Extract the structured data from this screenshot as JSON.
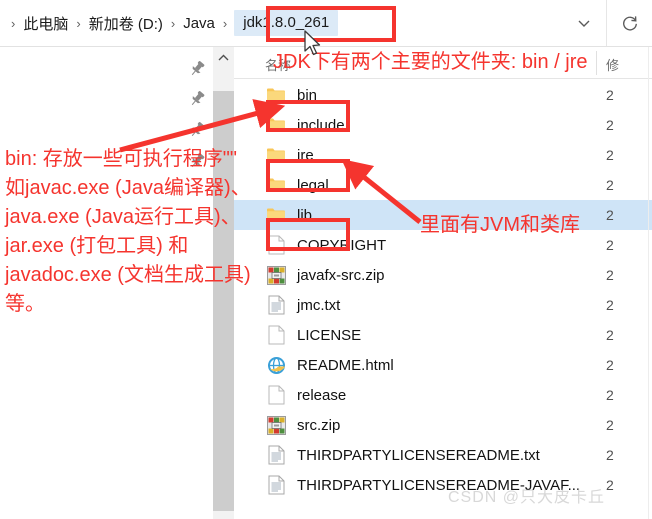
{
  "address_bar": {
    "breadcrumbs": [
      {
        "label": "此电脑"
      },
      {
        "label": "新加卷 (D:)"
      },
      {
        "label": "Java"
      }
    ],
    "current_folder": "jdk1.8.0_261",
    "separator": "›",
    "dropdown_icon": "chevron-down-icon",
    "refresh_icon": "refresh-icon"
  },
  "columns": {
    "name": "名称",
    "date": "修"
  },
  "files": [
    {
      "name": "bin",
      "icon": "folder-icon",
      "date": "2",
      "selected": false,
      "highlighted": true
    },
    {
      "name": "include",
      "icon": "folder-icon",
      "date": "2",
      "selected": false,
      "highlighted": false
    },
    {
      "name": "jre",
      "icon": "folder-icon",
      "date": "2",
      "selected": false,
      "highlighted": true
    },
    {
      "name": "legal",
      "icon": "folder-icon",
      "date": "2",
      "selected": false,
      "highlighted": false
    },
    {
      "name": "lib",
      "icon": "folder-icon",
      "date": "2",
      "selected": true,
      "highlighted": true
    },
    {
      "name": "COPYRIGHT",
      "icon": "blank-file-icon",
      "date": "2",
      "selected": false,
      "highlighted": false
    },
    {
      "name": "javafx-src.zip",
      "icon": "zip-icon",
      "date": "2",
      "selected": false,
      "highlighted": false
    },
    {
      "name": "jmc.txt",
      "icon": "text-file-icon",
      "date": "2",
      "selected": false,
      "highlighted": false
    },
    {
      "name": "LICENSE",
      "icon": "blank-file-icon",
      "date": "2",
      "selected": false,
      "highlighted": false
    },
    {
      "name": "README.html",
      "icon": "browser-icon",
      "date": "2",
      "selected": false,
      "highlighted": false
    },
    {
      "name": "release",
      "icon": "blank-file-icon",
      "date": "2",
      "selected": false,
      "highlighted": false
    },
    {
      "name": "src.zip",
      "icon": "zip-icon",
      "date": "2",
      "selected": false,
      "highlighted": false
    },
    {
      "name": "THIRDPARTYLICENSEREADME.txt",
      "icon": "text-file-icon",
      "date": "2",
      "selected": false,
      "highlighted": false
    },
    {
      "name": "THIRDPARTYLICENSEREADME-JAVAF...",
      "icon": "text-file-icon",
      "date": "2",
      "selected": false,
      "highlighted": false
    }
  ],
  "annotations": {
    "top": "JDK下有两个主要的文件夹: bin / jre",
    "right": "里面有JVM和类库",
    "left_lines": [
      "bin: 存放一些可执行程序\"\"",
      "如javac.exe (Java编译器)、",
      "java.exe (Java运行工具)、",
      "jar.exe (打包工具) 和",
      "javadoc.exe (文档生成工具)",
      "等。"
    ],
    "color": "#f5342e"
  },
  "watermark": "CSDN @只大皮卡丘",
  "pins": [
    {
      "icon": "pin-icon"
    },
    {
      "icon": "pin-icon"
    },
    {
      "icon": "pin-icon"
    },
    {
      "icon": "pin-icon"
    }
  ],
  "scrollbar": {
    "up_arrow_icon": "chevron-up-icon"
  }
}
